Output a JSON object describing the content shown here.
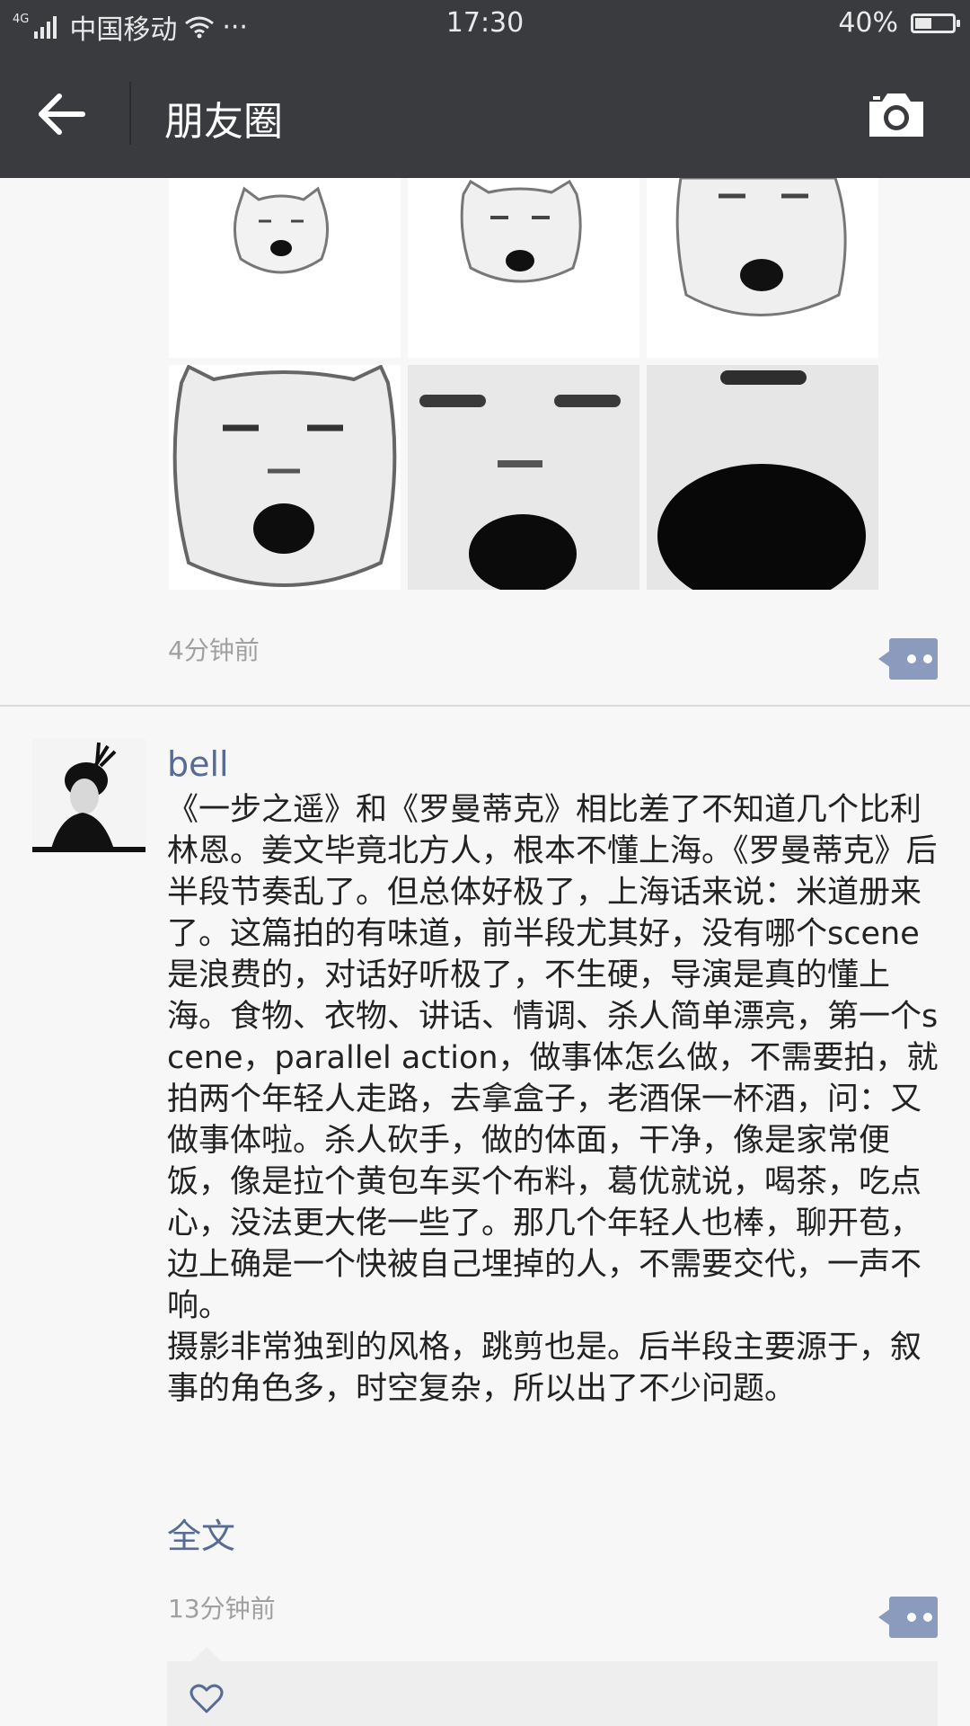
{
  "status_bar": {
    "network": "4G",
    "carrier": "中国移动",
    "more": "···",
    "time": "17:30",
    "battery": "40%",
    "battery_level": 0.4
  },
  "nav": {
    "title": "朋友圈",
    "back_icon": "back-arrow-icon",
    "camera_icon": "camera-icon"
  },
  "post1": {
    "time": "4分钟前",
    "photo_count": 6
  },
  "post2": {
    "username": "bell",
    "text": "《一步之遥》和《罗曼蒂克》相比差了不知道几个比利林恩。姜文毕竟北方人，根本不懂上海。《罗曼蒂克》后半段节奏乱了。但总体好极了，上海话来说：米道册来了。这篇拍的有味道，前半段尤其好，没有哪个scene是浪费的，对话好听极了，不生硬，导演是真的懂上海。食物、衣物、讲话、情调、杀人简单漂亮，第一个scene，parallel action，做事体怎么做，不需要拍，就拍两个年轻人走路，去拿盒子，老酒保一杯酒，问：又做事体啦。杀人砍手，做的体面，干净，像是家常便饭，像是拉个黄包车买个布料，葛优就说，喝茶，吃点心，没法更大佬一些了。那几个年轻人也棒，聊开苞，边上确是一个快被自己埋掉的人，不需要交代，一声不响。\n摄影非常独到的风格，跳剪也是。后半段主要源于，叙事的角色多，时空复杂，所以出了不少问题。",
    "full_text_link": "全文",
    "time": "13分钟前"
  },
  "colors": {
    "bar": "#3a3b3f",
    "link": "#576b95",
    "comment_button": "#8a9bbd",
    "background": "#f7f7f7"
  }
}
